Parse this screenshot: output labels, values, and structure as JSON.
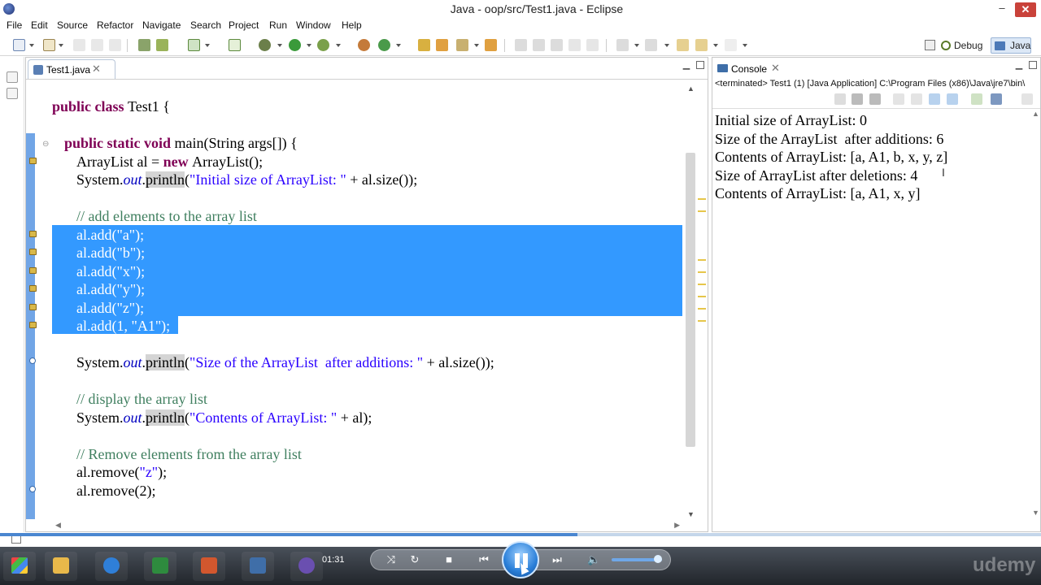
{
  "window": {
    "title": "Java - oop/src/Test1.java - Eclipse",
    "minimize": "–",
    "close": "✕"
  },
  "menu": [
    "File",
    "Edit",
    "Source",
    "Refactor",
    "Navigate",
    "Search",
    "Project",
    "Run",
    "Window",
    "Help"
  ],
  "perspectives": {
    "debug": "Debug",
    "java": "Java"
  },
  "editor": {
    "tab_label": "Test1.java",
    "tab_close": "✕",
    "code_lines": [
      [
        {
          "t": "public ",
          "c": "kw"
        },
        {
          "t": "class ",
          "c": "kw"
        },
        {
          "t": "Test1 {",
          "c": ""
        }
      ],
      [],
      [
        {
          "t": "public ",
          "c": "kw"
        },
        {
          "t": "static ",
          "c": "kw"
        },
        {
          "t": "void ",
          "c": "kw"
        },
        {
          "t": "main(String args[]) {",
          "c": ""
        }
      ],
      [
        {
          "t": "ArrayList al = ",
          "c": ""
        },
        {
          "t": "new ",
          "c": "kw"
        },
        {
          "t": "ArrayList();",
          "c": ""
        }
      ],
      [
        {
          "t": "System.",
          "c": ""
        },
        {
          "t": "out",
          "c": "it"
        },
        {
          "t": ".",
          "c": ""
        },
        {
          "t": "println",
          "c": "hl"
        },
        {
          "t": "(",
          "c": ""
        },
        {
          "t": "\"Initial size of ArrayList: \"",
          "c": "st"
        },
        {
          "t": " + al.size());",
          "c": ""
        }
      ],
      [],
      [
        {
          "t": "// add elements to the array list",
          "c": "cm"
        }
      ],
      [
        {
          "t": "al.add(\"a\");",
          "c": "selt"
        }
      ],
      [
        {
          "t": "al.add(\"b\");",
          "c": "selt"
        }
      ],
      [
        {
          "t": "al.add(\"x\");",
          "c": "selt"
        }
      ],
      [
        {
          "t": "al.add(\"y\");",
          "c": "selt"
        }
      ],
      [
        {
          "t": "al.add(\"z\");",
          "c": "selt"
        }
      ],
      [
        {
          "t": "al.add(1, \"A1\");",
          "c": "selt"
        }
      ],
      [],
      [
        {
          "t": "System.",
          "c": ""
        },
        {
          "t": "out",
          "c": "it"
        },
        {
          "t": ".",
          "c": ""
        },
        {
          "t": "println",
          "c": "hl"
        },
        {
          "t": "(",
          "c": ""
        },
        {
          "t": "\"Size of the ArrayList  after additions: \"",
          "c": "st"
        },
        {
          "t": " + al.size());",
          "c": ""
        }
      ],
      [],
      [
        {
          "t": "// display the array list",
          "c": "cm"
        }
      ],
      [
        {
          "t": "System.",
          "c": ""
        },
        {
          "t": "out",
          "c": "it"
        },
        {
          "t": ".",
          "c": ""
        },
        {
          "t": "println",
          "c": "hl"
        },
        {
          "t": "(",
          "c": ""
        },
        {
          "t": "\"Contents of ArrayList: \"",
          "c": "st"
        },
        {
          "t": " + al);",
          "c": ""
        }
      ],
      [],
      [
        {
          "t": "// Remove elements from the array list",
          "c": "cm"
        }
      ],
      [
        {
          "t": "al.remove(",
          "c": ""
        },
        {
          "t": "\"z\"",
          "c": "st"
        },
        {
          "t": ");",
          "c": ""
        }
      ],
      [
        {
          "t": "al.remove(2);",
          "c": ""
        }
      ]
    ]
  },
  "console": {
    "tab_label": "Console",
    "tab_close": "✕",
    "header": "<terminated> Test1 (1) [Java Application] C:\\Program Files (x86)\\Java\\jre7\\bin\\",
    "output": [
      "Initial size of ArrayList: 0",
      "Size of the ArrayList  after additions: 6",
      "Contents of ArrayList: [a, A1, b, x, y, z]",
      "Size of ArrayList after deletions: 4",
      "Contents of ArrayList: [a, A1, x, y]"
    ]
  },
  "video": {
    "time": "01:31",
    "progress": 0.555,
    "watermark": "udemy"
  },
  "colors": {
    "keyword": "#7f0055",
    "comment": "#3f7f5f",
    "string": "#2a00ff",
    "selection": "#3399ff"
  }
}
